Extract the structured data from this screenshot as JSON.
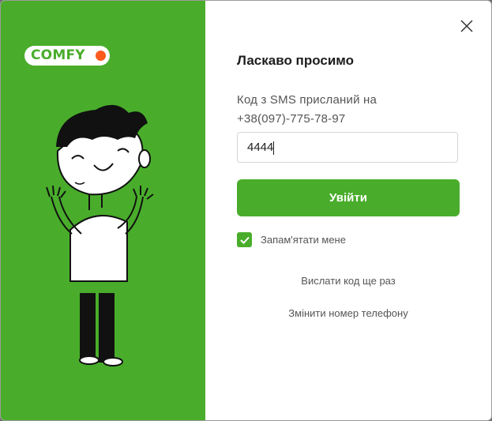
{
  "logo": {
    "text": "COMFY",
    "brand_color": "#49ad2b",
    "dot_color": "#ff5b1e"
  },
  "title": "Ласкаво просимо",
  "sms_label_line1": "Код з SMS присланий на",
  "sms_label_line2": "+38(097)-775-78-97",
  "code_input": {
    "value": "4444"
  },
  "submit_label": "Увійти",
  "remember": {
    "label": "Запам'ятати мене",
    "checked": true
  },
  "resend_link": "Вислати код ще раз",
  "change_phone_link": "Змінити номер телефону",
  "icons": {
    "close": "close-icon",
    "check": "check-icon",
    "illustration": "waving-boy-illustration"
  }
}
